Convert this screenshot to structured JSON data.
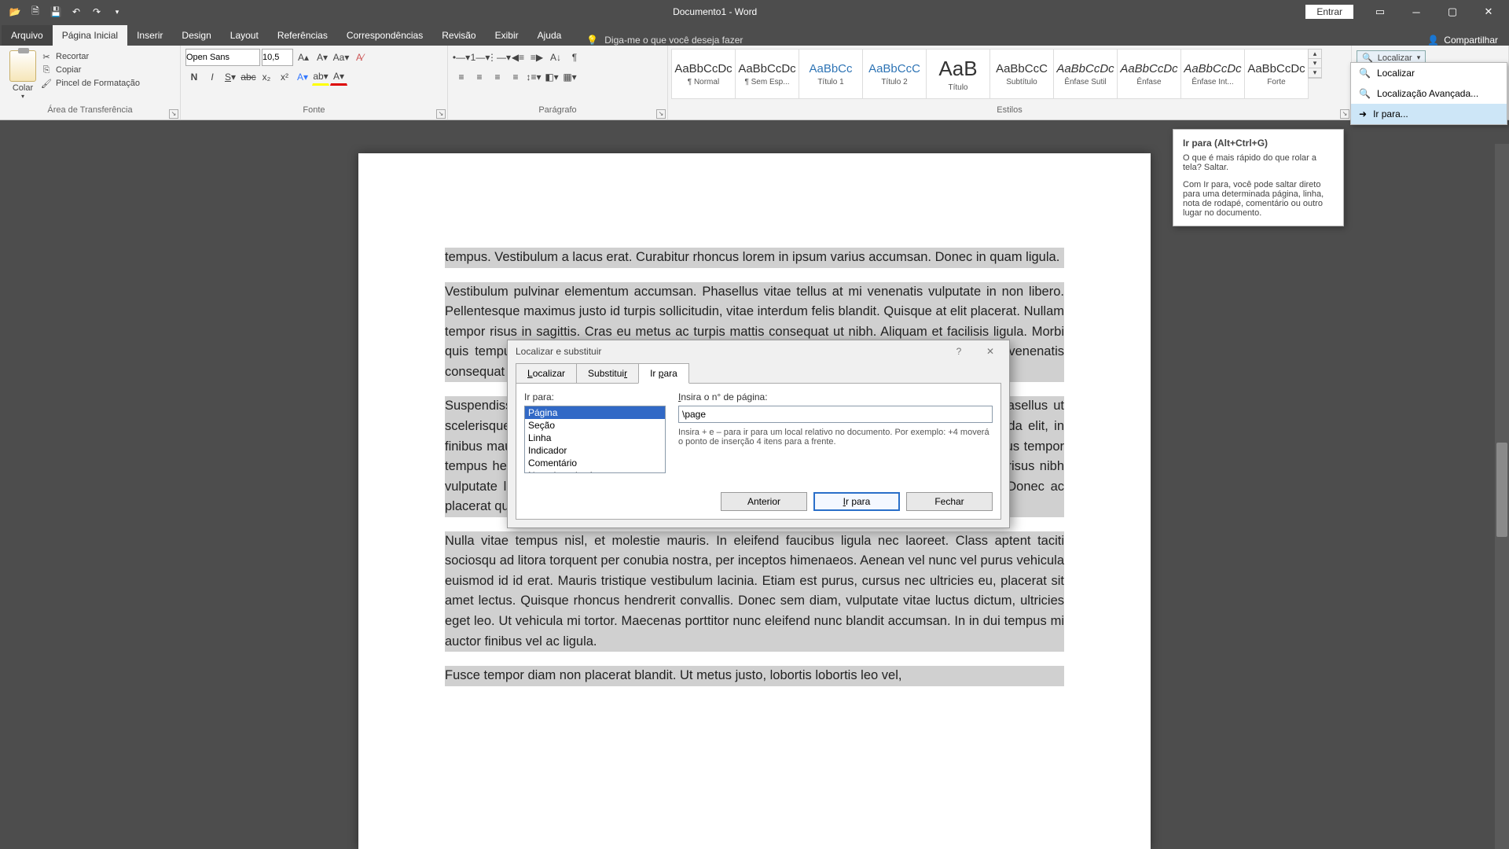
{
  "title": "Documento1 - Word",
  "login": "Entrar",
  "share": "Compartilhar",
  "tabs": [
    "Arquivo",
    "Página Inicial",
    "Inserir",
    "Design",
    "Layout",
    "Referências",
    "Correspondências",
    "Revisão",
    "Exibir",
    "Ajuda"
  ],
  "tellme": "Diga-me o que você deseja fazer",
  "groups": {
    "clipboard": {
      "label": "Área de Transferência",
      "paste": "Colar",
      "cut": "Recortar",
      "copy": "Copiar",
      "painter": "Pincel de Formatação"
    },
    "font": {
      "label": "Fonte",
      "name": "Open Sans",
      "size": "10,5"
    },
    "paragraph": {
      "label": "Parágrafo"
    },
    "styles": {
      "label": "Estilos",
      "items": [
        {
          "preview": "AaBbCcDc",
          "name": "¶ Normal"
        },
        {
          "preview": "AaBbCcDc",
          "name": "¶ Sem Esp..."
        },
        {
          "preview": "AaBbCc",
          "name": "Título 1",
          "blue": true
        },
        {
          "preview": "AaBbCcC",
          "name": "Título 2",
          "blue": true
        },
        {
          "preview": "AaB",
          "name": "Título",
          "big": true
        },
        {
          "preview": "AaBbCcC",
          "name": "Subtítulo"
        },
        {
          "preview": "AaBbCcDc",
          "name": "Ênfase Sutil",
          "ital": true
        },
        {
          "preview": "AaBbCcDc",
          "name": "Ênfase",
          "ital": true
        },
        {
          "preview": "AaBbCcDc",
          "name": "Ênfase Int...",
          "ital": true
        },
        {
          "preview": "AaBbCcDc",
          "name": "Forte"
        }
      ]
    },
    "editing": {
      "find": "Localizar"
    }
  },
  "find_menu": {
    "find": "Localizar",
    "advanced": "Localização Avançada...",
    "goto": "Ir para..."
  },
  "tooltip": {
    "title": "Ir para (Alt+Ctrl+G)",
    "line1": "O que é mais rápido do que rolar a tela? Saltar.",
    "line2": "Com Ir para, você pode saltar direto para uma determinada página, linha, nota de rodapé, comentário ou outro lugar no documento."
  },
  "doc": {
    "p1": "tempus. Vestibulum a lacus erat. Curabitur rhoncus lorem in ipsum varius accumsan. Donec in quam ligula.",
    "p2": "Vestibulum pulvinar elementum accumsan. Phasellus vitae tellus at mi venenatis vulputate in non libero. Pellentesque maximus justo id turpis sollicitudin, vitae interdum felis blandit. Quisque at elit placerat. Nullam tempor risus in sagittis. Cras eu metus ac turpis mattis consequat ut nibh. Aliquam et facilisis ligula. Morbi quis tempus neque. Integer dignissim leo vitae eros facilisis. In blandit tincidunt tellus. Nulla venenatis consequat nunc.",
    "p3": "Suspendisse ac lectus tristique risus ante, in auctor lacus vestibulum. Phasellus facilisis a. Phasellus ut scelerisque nulla. Ut sollicitudin lectus libero, eget iaculis lorem mollis eget. Cras aliquet gravida elit, in finibus mauris malesuada id. Sed tincidunt aliquet dui in malesuada. Etiam ut quam nisi. Phasellus tempor tempus hendrerit. Fusce semper ut felis quis dapibus. Fusce cursus, dolor at suscipit aliquam, risus nibh vulputate lectus, sit amet dignissim ante est quis est. Mauris pulvinar nec nunc sed fringilla. Donec ac placerat quam.",
    "p4": "Nulla vitae tempus nisl, et molestie mauris. In eleifend faucibus ligula nec laoreet. Class aptent taciti sociosqu ad litora torquent per conubia nostra, per inceptos himenaeos. Aenean vel nunc vel purus vehicula euismod id id erat. Mauris tristique vestibulum lacinia. Etiam est purus, cursus nec ultricies eu, placerat sit amet lectus. Quisque rhoncus hendrerit convallis. Donec sem diam, vulputate vitae luctus dictum, ultricies eget leo. Ut vehicula mi tortor. Maecenas porttitor nunc eleifend nunc blandit accumsan. In in dui tempus mi auctor finibus vel ac ligula.",
    "p5": "Fusce tempor diam non placerat blandit. Ut metus justo, lobortis lobortis leo vel,"
  },
  "dialog": {
    "title": "Localizar e substituir",
    "tabs": {
      "find": "Localizar",
      "replace": "Substituir",
      "goto": "Ir para"
    },
    "goto_label": "Ir para:",
    "goto_items": [
      "Página",
      "Seção",
      "Linha",
      "Indicador",
      "Comentário",
      "Nota de rodapé"
    ],
    "input_label": "Insira o n° de página:",
    "input_value": "\\page",
    "hint": "Insira + e – para ir para um local relativo no documento. Por exemplo: +4 moverá o ponto de inserção 4 itens para a frente.",
    "btn_prev": "Anterior",
    "btn_go": "Ir para",
    "btn_close": "Fechar"
  }
}
